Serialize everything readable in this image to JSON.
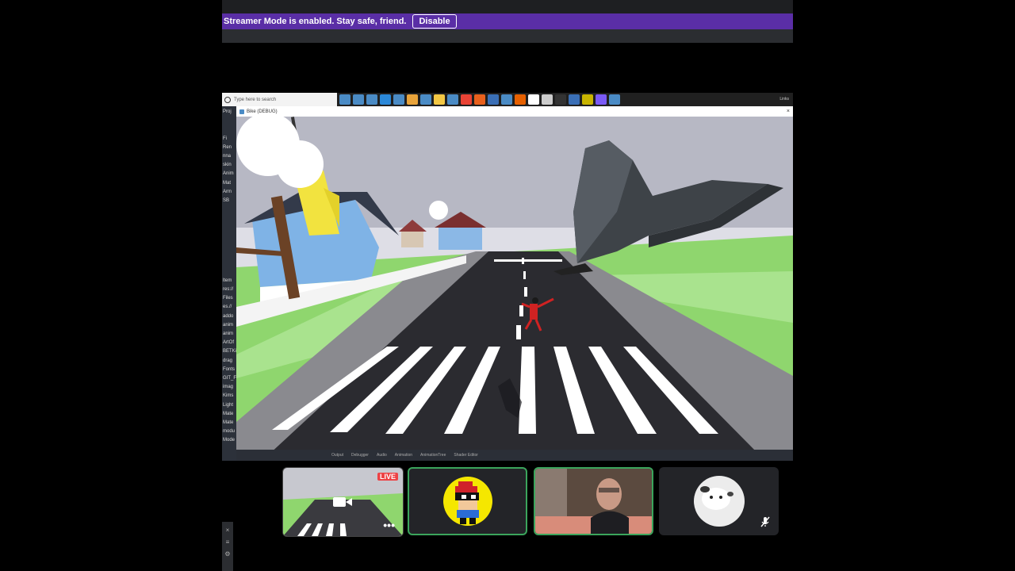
{
  "banner": {
    "message": "Streamer Mode is enabled. Stay safe, friend.",
    "button_label": "Disable"
  },
  "taskbar": {
    "search_placeholder": "Type here to search",
    "right_label": "Links",
    "icon_colors": [
      "#4a8bc5",
      "#4a8bc5",
      "#4a8bc5",
      "#2b88d8",
      "#4a8bc5",
      "#e8a33a",
      "#4a8bc5",
      "#f2c744",
      "#4a8bc5",
      "#e94335",
      "#e8601c",
      "#3a6fb6",
      "#4a8bc5",
      "#e66000",
      "#ffffff",
      "#cccccc",
      "#333333",
      "#3a6fb6",
      "#c8b400",
      "#7a5af5",
      "#4a8bc5"
    ]
  },
  "editor_panel": {
    "items": [
      "Proj",
      "",
      "",
      "Fi",
      "Ren",
      "nna",
      "skin",
      "Anim",
      "Mat",
      "Arm",
      "SB",
      "",
      "",
      "",
      "",
      "",
      "",
      "",
      "",
      "ltem",
      "res://",
      "Files",
      "es.//",
      "addo",
      "anim",
      "anim",
      "ArtOf",
      "BETKit",
      "drag",
      "Fonts",
      "GIT_F",
      "imag",
      "Kims",
      "Light",
      "Mate",
      "Mate",
      "modu",
      "Mode"
    ]
  },
  "game_window": {
    "title": "Bike (DEBUG)",
    "close_glyph": "×"
  },
  "bottom_bar": {
    "labels": [
      "Output",
      "Debugger",
      "Audio",
      "Animation",
      "AnimationTree",
      "Shader Editor"
    ]
  },
  "tiles": {
    "stream_badge": "LIVE",
    "more_glyph": "•••"
  },
  "side_mini": {
    "glyphs": [
      "×",
      "≡",
      "⚙"
    ]
  },
  "colors": {
    "banner": "#5a2ea6",
    "speaking_border": "#3ba55c",
    "live_badge": "#ed4245"
  }
}
